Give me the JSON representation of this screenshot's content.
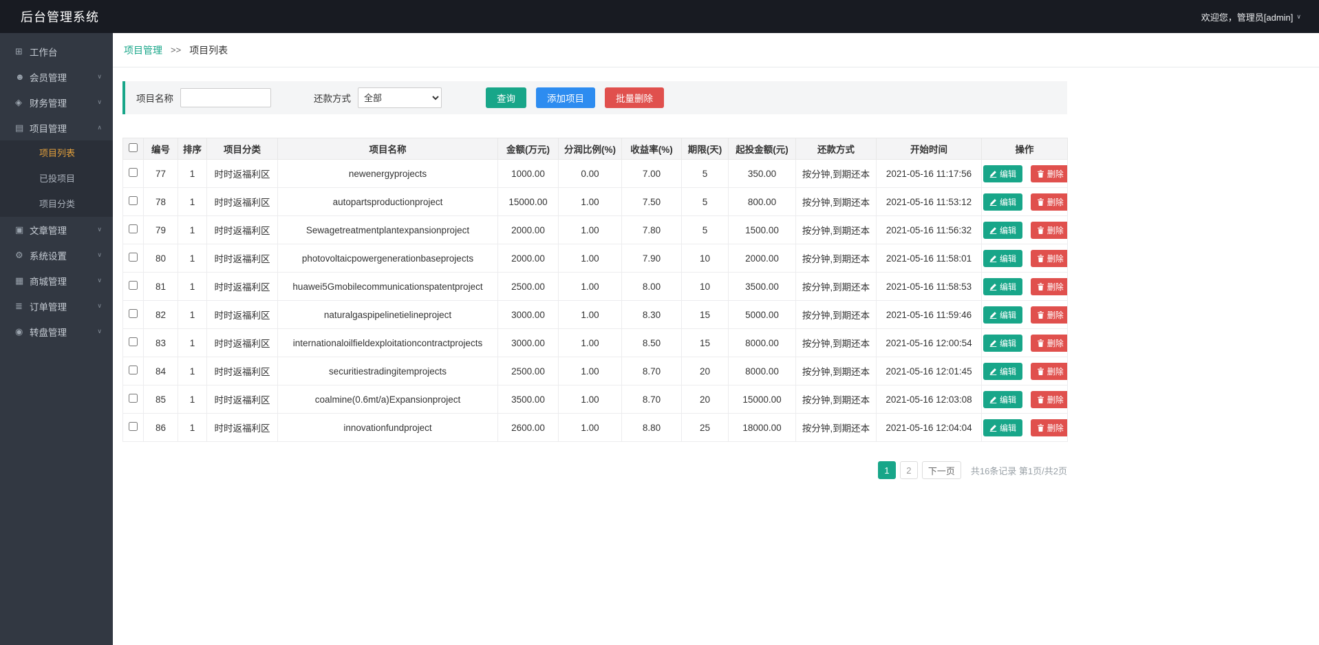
{
  "colors": {
    "topbar_bg": "#181b22",
    "sidebar_bg": "#323842",
    "primary_green": "#18a689",
    "add_blue": "#2d8cf0",
    "danger_red": "#e0504d",
    "sidebar_active_text": "#e6a23c"
  },
  "app": {
    "title": "后台管理系统",
    "welcome": "欢迎您，管理员[admin]"
  },
  "sidebar": {
    "items": [
      {
        "key": "workbench",
        "label": "工作台",
        "icon": "⊞",
        "icon_name": "workbench-icon"
      },
      {
        "key": "members",
        "label": "会员管理",
        "icon": "☻",
        "icon_name": "members-icon",
        "chevron": "down"
      },
      {
        "key": "finance",
        "label": "财务管理",
        "icon": "◈",
        "icon_name": "finance-icon",
        "chevron": "down"
      },
      {
        "key": "projects",
        "label": "项目管理",
        "icon": "▤",
        "icon_name": "projects-icon",
        "chevron": "up",
        "children": [
          {
            "key": "project-list",
            "label": "项目列表",
            "active": true
          },
          {
            "key": "invested-projects",
            "label": "已投项目"
          },
          {
            "key": "project-categories",
            "label": "项目分类"
          }
        ]
      },
      {
        "key": "articles",
        "label": "文章管理",
        "icon": "▣",
        "icon_name": "articles-icon",
        "chevron": "down"
      },
      {
        "key": "settings",
        "label": "系统设置",
        "icon": "⚙",
        "icon_name": "gear-icon",
        "chevron": "down"
      },
      {
        "key": "mall",
        "label": "商城管理",
        "icon": "▦",
        "icon_name": "mall-icon",
        "chevron": "down"
      },
      {
        "key": "orders",
        "label": "订单管理",
        "icon": "≣",
        "icon_name": "orders-icon",
        "chevron": "down"
      },
      {
        "key": "wheel",
        "label": "转盘管理",
        "icon": "◉",
        "icon_name": "wheel-icon",
        "chevron": "down"
      }
    ]
  },
  "breadcrumb": {
    "parent": "项目管理",
    "separator": ">>",
    "current": "项目列表"
  },
  "filter": {
    "name_label": "项目名称",
    "name_value": "",
    "repay_label": "还款方式",
    "repay_value": "全部",
    "search_button": "查询",
    "add_button": "添加项目",
    "bulk_delete_button": "批量删除"
  },
  "table": {
    "headers": [
      "编号",
      "排序",
      "项目分类",
      "项目名称",
      "金额(万元)",
      "分润比例(%)",
      "收益率(%)",
      "期限(天)",
      "起投金额(元)",
      "还款方式",
      "开始时间",
      "操作"
    ],
    "edit_label": "编辑",
    "delete_label": "删除",
    "rows": [
      {
        "id": "77",
        "sort": "1",
        "category": "时时返福利区",
        "name": "newenergyprojects",
        "amount": "1000.00",
        "share": "0.00",
        "rate": "7.00",
        "days": "5",
        "min": "350.00",
        "repay": "按分钟,到期还本",
        "start": "2021-05-16 11:17:56"
      },
      {
        "id": "78",
        "sort": "1",
        "category": "时时返福利区",
        "name": "autopartsproductionproject",
        "amount": "15000.00",
        "share": "1.00",
        "rate": "7.50",
        "days": "5",
        "min": "800.00",
        "repay": "按分钟,到期还本",
        "start": "2021-05-16 11:53:12"
      },
      {
        "id": "79",
        "sort": "1",
        "category": "时时返福利区",
        "name": "Sewagetreatmentplantexpansionproject",
        "amount": "2000.00",
        "share": "1.00",
        "rate": "7.80",
        "days": "5",
        "min": "1500.00",
        "repay": "按分钟,到期还本",
        "start": "2021-05-16 11:56:32"
      },
      {
        "id": "80",
        "sort": "1",
        "category": "时时返福利区",
        "name": "photovoltaicpowergenerationbaseprojects",
        "amount": "2000.00",
        "share": "1.00",
        "rate": "7.90",
        "days": "10",
        "min": "2000.00",
        "repay": "按分钟,到期还本",
        "start": "2021-05-16 11:58:01"
      },
      {
        "id": "81",
        "sort": "1",
        "category": "时时返福利区",
        "name": "huawei5Gmobilecommunicationspatentproject",
        "amount": "2500.00",
        "share": "1.00",
        "rate": "8.00",
        "days": "10",
        "min": "3500.00",
        "repay": "按分钟,到期还本",
        "start": "2021-05-16 11:58:53"
      },
      {
        "id": "82",
        "sort": "1",
        "category": "时时返福利区",
        "name": "naturalgaspipelinetielineproject",
        "amount": "3000.00",
        "share": "1.00",
        "rate": "8.30",
        "days": "15",
        "min": "5000.00",
        "repay": "按分钟,到期还本",
        "start": "2021-05-16 11:59:46"
      },
      {
        "id": "83",
        "sort": "1",
        "category": "时时返福利区",
        "name": "internationaloilfieldexploitationcontractprojects",
        "amount": "3000.00",
        "share": "1.00",
        "rate": "8.50",
        "days": "15",
        "min": "8000.00",
        "repay": "按分钟,到期还本",
        "start": "2021-05-16 12:00:54"
      },
      {
        "id": "84",
        "sort": "1",
        "category": "时时返福利区",
        "name": "securitiestradingitemprojects",
        "amount": "2500.00",
        "share": "1.00",
        "rate": "8.70",
        "days": "20",
        "min": "8000.00",
        "repay": "按分钟,到期还本",
        "start": "2021-05-16 12:01:45"
      },
      {
        "id": "85",
        "sort": "1",
        "category": "时时返福利区",
        "name": "coalmine(0.6mt/a)Expansionproject",
        "amount": "3500.00",
        "share": "1.00",
        "rate": "8.70",
        "days": "20",
        "min": "15000.00",
        "repay": "按分钟,到期还本",
        "start": "2021-05-16 12:03:08"
      },
      {
        "id": "86",
        "sort": "1",
        "category": "时时返福利区",
        "name": "innovationfundproject",
        "amount": "2600.00",
        "share": "1.00",
        "rate": "8.80",
        "days": "25",
        "min": "18000.00",
        "repay": "按分钟,到期还本",
        "start": "2021-05-16 12:04:04"
      }
    ]
  },
  "pagination": {
    "pages": [
      "1",
      "2"
    ],
    "active": "1",
    "next_label": "下一页",
    "summary": "共16条记录 第1页/共2页"
  }
}
